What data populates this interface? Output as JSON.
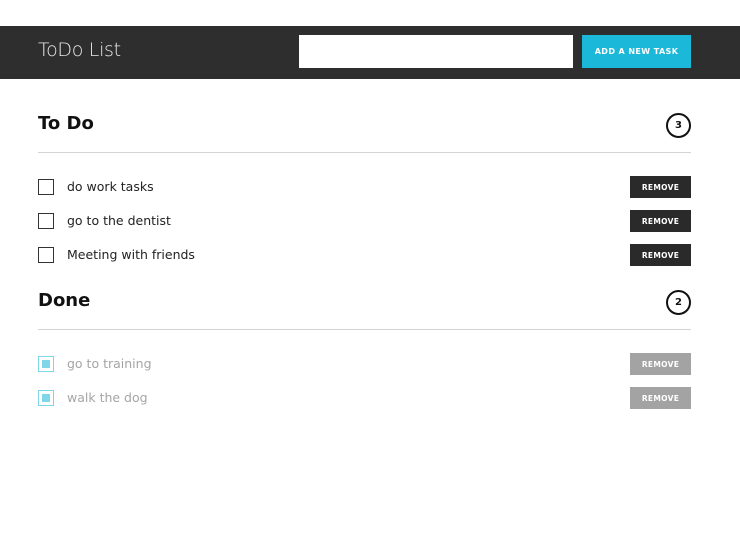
{
  "header": {
    "title": "ToDo List",
    "input_value": "",
    "input_placeholder": "",
    "add_button_label": "ADD A NEW TASK"
  },
  "todo": {
    "title": "To Do",
    "count": "3",
    "items": [
      {
        "text": "do work tasks",
        "checked": false,
        "remove_label": "REMOVE"
      },
      {
        "text": "go to the dentist",
        "checked": false,
        "remove_label": "REMOVE"
      },
      {
        "text": "Meeting with friends",
        "checked": false,
        "remove_label": "REMOVE"
      }
    ]
  },
  "done": {
    "title": "Done",
    "count": "2",
    "items": [
      {
        "text": "go to training",
        "checked": true,
        "remove_label": "REMOVE"
      },
      {
        "text": "walk the dog",
        "checked": true,
        "remove_label": "REMOVE"
      }
    ]
  },
  "colors": {
    "header_bg": "#2e2e2e",
    "accent": "#1cb8d9",
    "checked_box": "#7fd6e8",
    "remove_active": "#2a2a2a",
    "remove_done": "#a3a3a3",
    "done_text": "#a5a5a5"
  },
  "icons": {
    "checkbox_unchecked": "checkbox-icon",
    "checkbox_checked": "checkbox-checked-icon"
  }
}
